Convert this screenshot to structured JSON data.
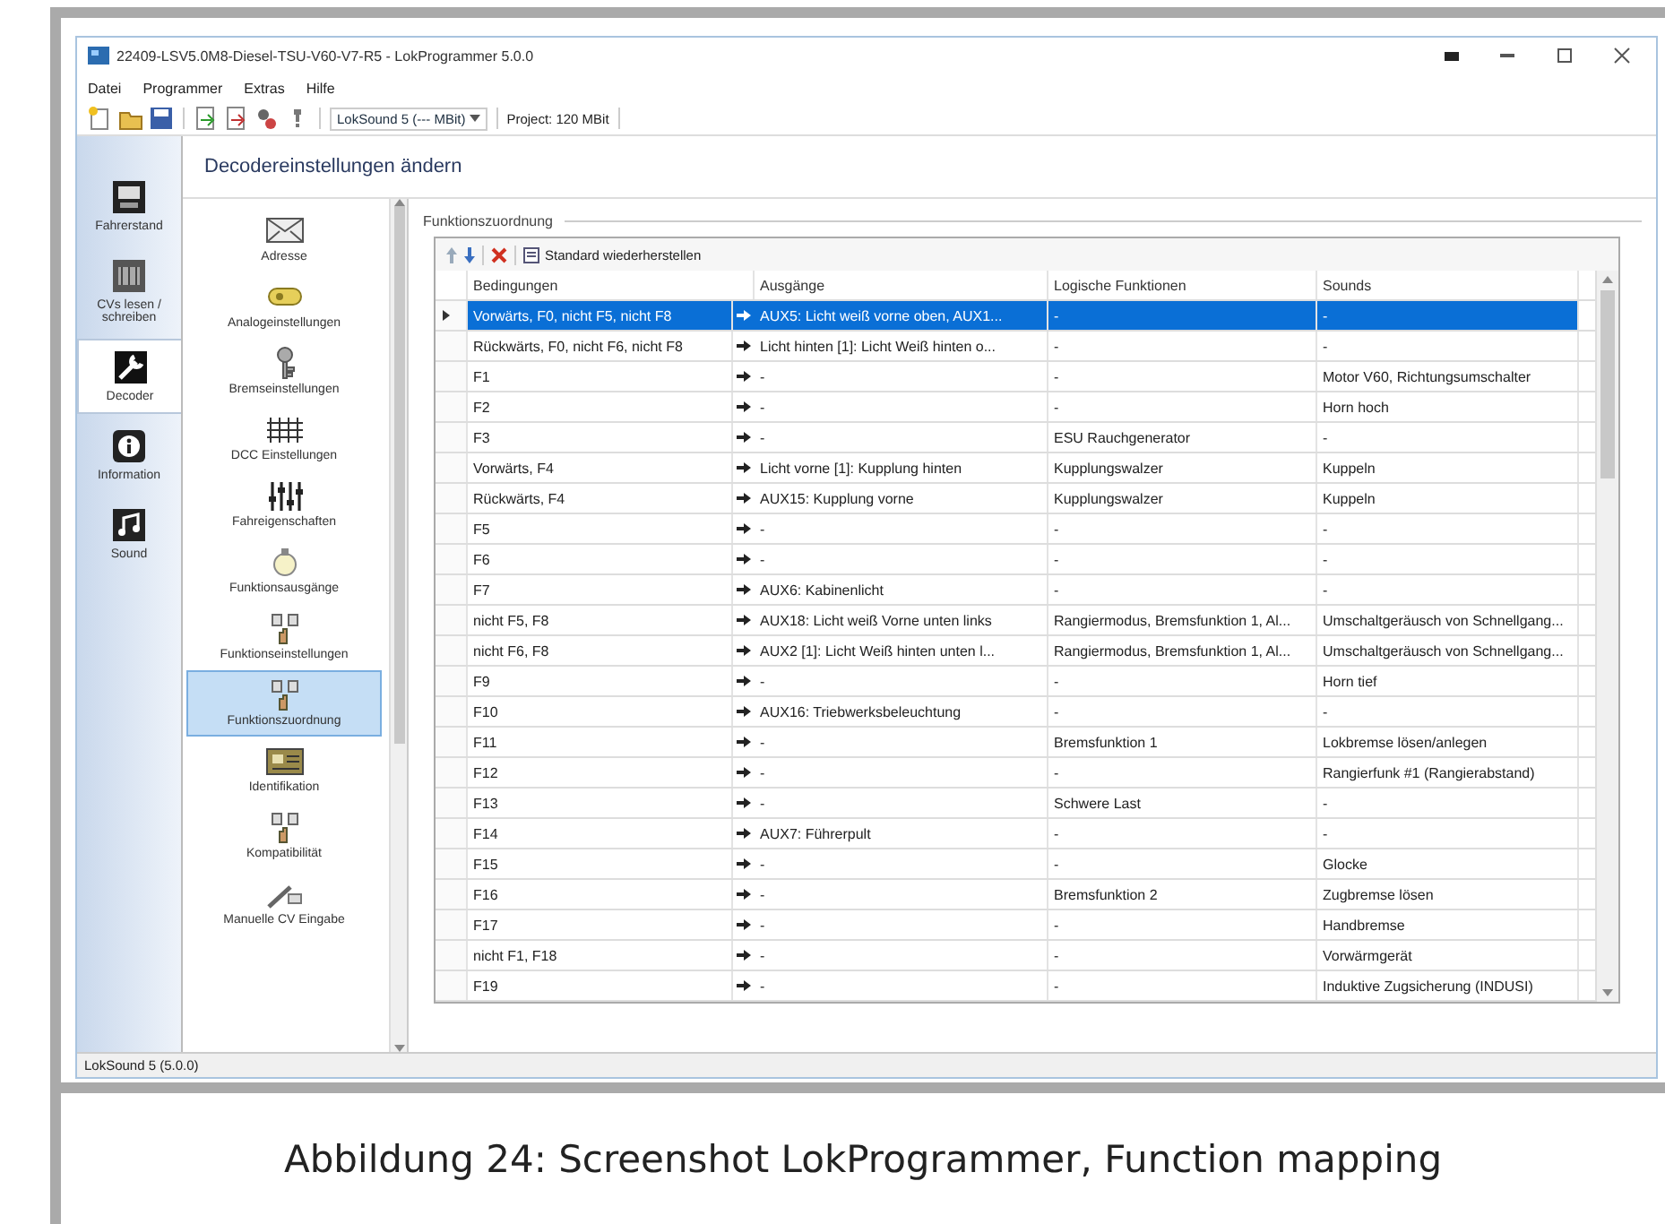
{
  "window": {
    "title": "22409-LSV5.0M8-Diesel-TSU-V60-V7-R5 - LokProgrammer 5.0.0"
  },
  "menu": [
    "Datei",
    "Programmer",
    "Extras",
    "Hilfe"
  ],
  "toolbar": {
    "decoder": "LokSound 5 (--- MBit)",
    "project": "Project: 120 MBit"
  },
  "header": "Decodereinstellungen ändern",
  "nav": [
    {
      "label": "Fahrerstand",
      "selected": false
    },
    {
      "label": "CVs lesen / schreiben",
      "selected": false
    },
    {
      "label": "Decoder",
      "selected": true
    },
    {
      "label": "Information",
      "selected": false
    },
    {
      "label": "Sound",
      "selected": false
    }
  ],
  "settings": [
    {
      "label": "Adresse",
      "selected": false
    },
    {
      "label": "Analogeinstellungen",
      "selected": false
    },
    {
      "label": "Bremseinstellungen",
      "selected": false
    },
    {
      "label": "DCC Einstellungen",
      "selected": false
    },
    {
      "label": "Fahreigenschaften",
      "selected": false
    },
    {
      "label": "Funktionsausgänge",
      "selected": false
    },
    {
      "label": "Funktionseinstellungen",
      "selected": false
    },
    {
      "label": "Funktionszuordnung",
      "selected": true
    },
    {
      "label": "Identifikation",
      "selected": false
    },
    {
      "label": "Kompatibilität",
      "selected": false
    },
    {
      "label": "Manuelle CV Eingabe",
      "selected": false
    }
  ],
  "group_title": "Funktionszuordnung",
  "table_toolbar": {
    "restore_button": "Standard wiederherstellen"
  },
  "table": {
    "columns": [
      "Bedingungen",
      "Ausgänge",
      "Logische Funktionen",
      "Sounds"
    ],
    "rows": [
      {
        "selected": true,
        "cells": [
          "Vorwärts, F0, nicht F5, nicht F8",
          "AUX5: Licht weiß vorne oben, AUX1...",
          "-",
          "-"
        ]
      },
      {
        "selected": false,
        "cells": [
          "Rückwärts, F0, nicht F6, nicht F8",
          "Licht hinten [1]: Licht Weiß hinten o...",
          "-",
          "-"
        ]
      },
      {
        "selected": false,
        "cells": [
          "F1",
          "-",
          "-",
          "Motor V60, Richtungsumschalter"
        ]
      },
      {
        "selected": false,
        "cells": [
          "F2",
          "-",
          "-",
          "Horn hoch"
        ]
      },
      {
        "selected": false,
        "cells": [
          "F3",
          "-",
          "ESU Rauchgenerator",
          "-"
        ]
      },
      {
        "selected": false,
        "cells": [
          "Vorwärts, F4",
          "Licht vorne [1]: Kupplung hinten",
          "Kupplungswalzer",
          "Kuppeln"
        ]
      },
      {
        "selected": false,
        "cells": [
          "Rückwärts, F4",
          "AUX15: Kupplung vorne",
          "Kupplungswalzer",
          "Kuppeln"
        ]
      },
      {
        "selected": false,
        "cells": [
          "F5",
          "-",
          "-",
          "-"
        ]
      },
      {
        "selected": false,
        "cells": [
          "F6",
          "-",
          "-",
          "-"
        ]
      },
      {
        "selected": false,
        "cells": [
          "F7",
          "AUX6: Kabinenlicht",
          "-",
          "-"
        ]
      },
      {
        "selected": false,
        "cells": [
          "nicht F5, F8",
          "AUX18: Licht weiß Vorne unten links",
          "Rangiermodus, Bremsfunktion 1, Al...",
          "Umschaltgeräusch von Schnellgang..."
        ]
      },
      {
        "selected": false,
        "cells": [
          "nicht F6, F8",
          "AUX2 [1]: Licht Weiß hinten unten l...",
          "Rangiermodus, Bremsfunktion 1, Al...",
          "Umschaltgeräusch von Schnellgang..."
        ]
      },
      {
        "selected": false,
        "cells": [
          "F9",
          "-",
          "-",
          "Horn tief"
        ]
      },
      {
        "selected": false,
        "cells": [
          "F10",
          "AUX16: Triebwerksbeleuchtung",
          "-",
          "-"
        ]
      },
      {
        "selected": false,
        "cells": [
          "F11",
          "-",
          "Bremsfunktion 1",
          "Lokbremse lösen/anlegen"
        ]
      },
      {
        "selected": false,
        "cells": [
          "F12",
          "-",
          "-",
          "Rangierfunk #1 (Rangierabstand)"
        ]
      },
      {
        "selected": false,
        "cells": [
          "F13",
          "-",
          "Schwere Last",
          "-"
        ]
      },
      {
        "selected": false,
        "cells": [
          "F14",
          "AUX7: Führerpult",
          "-",
          "-"
        ]
      },
      {
        "selected": false,
        "cells": [
          "F15",
          "-",
          "-",
          "Glocke"
        ]
      },
      {
        "selected": false,
        "cells": [
          "F16",
          "-",
          "Bremsfunktion 2",
          "Zugbremse lösen"
        ]
      },
      {
        "selected": false,
        "cells": [
          "F17",
          "-",
          "-",
          "Handbremse"
        ]
      },
      {
        "selected": false,
        "cells": [
          "nicht F1, F18",
          "-",
          "-",
          "Vorwärmgerät"
        ]
      },
      {
        "selected": false,
        "cells": [
          "F19",
          "-",
          "-",
          "Induktive Zugsicherung (INDUSI)"
        ]
      }
    ]
  },
  "status_bar": "LokSound 5 (5.0.0)",
  "caption": "Abbildung 24: Screenshot LokProgrammer, Function mapping"
}
